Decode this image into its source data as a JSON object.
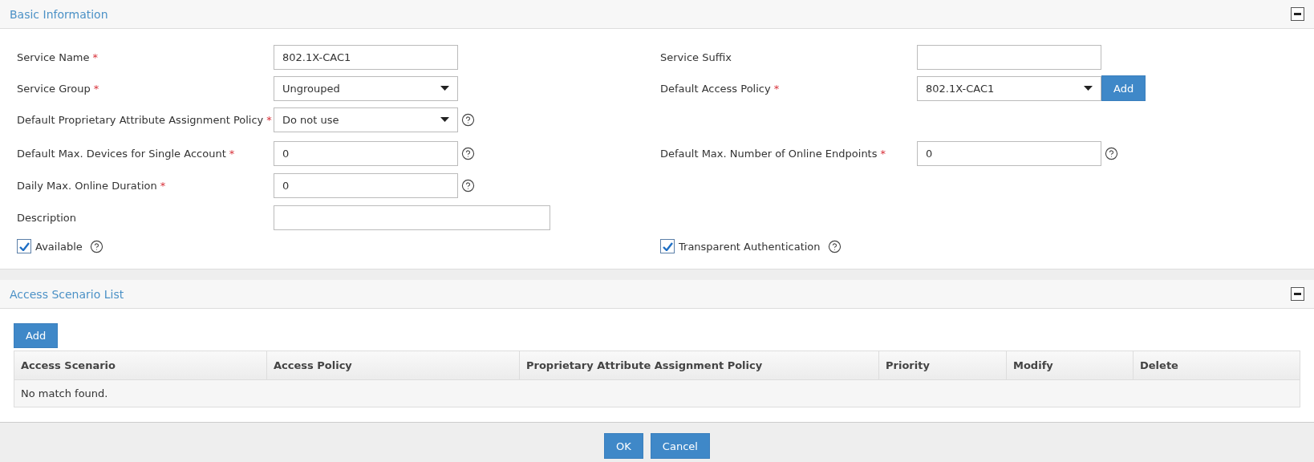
{
  "basic_information": {
    "title": "Basic Information",
    "collapsed": false,
    "rows": [
      {
        "left": {
          "label": "Service Name",
          "mark": "*",
          "kind": "text",
          "value": "802.1X-CAC1"
        },
        "right": {
          "label": "Service Suffix",
          "kind": "text"
        }
      },
      {
        "left": {
          "label": "Service Group",
          "mark": "*",
          "kind": "select",
          "value": "Ungrouped"
        },
        "right": {
          "label": "Default Access Policy",
          "mark": "*",
          "kind": "select",
          "value": "802.1X-CAC1",
          "button": "Add"
        }
      },
      {
        "left": {
          "label": "Default Proprietary Attribute Assignment Policy",
          "mark": "*",
          "kind": "select",
          "value": "Do not use",
          "help": true
        }
      },
      {
        "left": {
          "label": "Default Max. Devices for Single Account",
          "mark": "*",
          "kind": "text",
          "value": "0",
          "help": true
        },
        "right": {
          "label": "Default Max. Number of Online Endpoints",
          "mark": "*",
          "kind": "text",
          "value": "0",
          "help": true
        }
      },
      {
        "left": {
          "label": "Daily Max. Online Duration",
          "mark": "*",
          "kind": "text",
          "value": "0",
          "help": true
        }
      },
      {
        "left": {
          "label": "Description",
          "kind": "wide"
        }
      }
    ],
    "checkboxes": [
      {
        "label": "Available",
        "checked": true,
        "help": true
      },
      {
        "label": "Transparent Authentication",
        "checked": true,
        "help": true
      }
    ]
  },
  "access_scenario_list": {
    "title": "Access Scenario List",
    "collapsed": false,
    "add_button": "Add",
    "table": {
      "columns": [
        "Access Scenario",
        "Access Policy",
        "Proprietary Attribute Assignment Policy",
        "Priority",
        "Modify",
        "Delete"
      ],
      "empty_message": "No match found."
    }
  },
  "footer": {
    "buttons": [
      "OK",
      "Cancel"
    ]
  }
}
